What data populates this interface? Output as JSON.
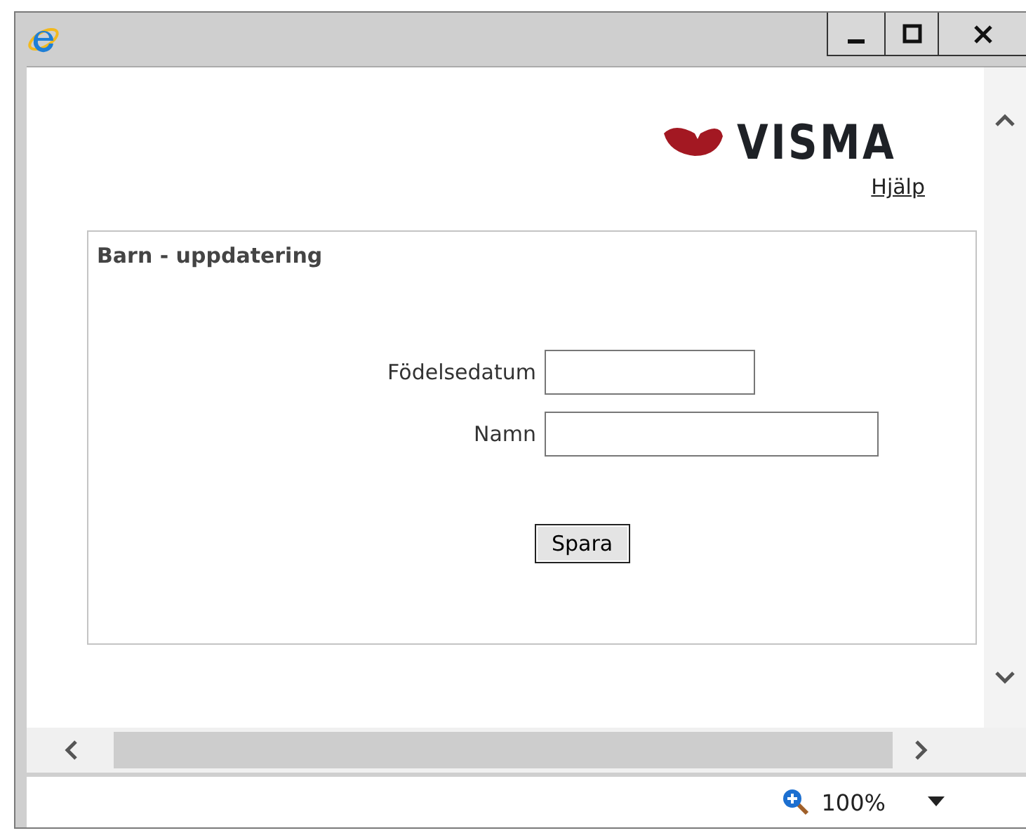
{
  "logo": {
    "text": "VISMA"
  },
  "help_link": "Hjälp",
  "form": {
    "title": "Barn - uppdatering",
    "fields": [
      {
        "label": "Födelsedatum",
        "kind": "date"
      },
      {
        "label": "Namn",
        "kind": "text"
      }
    ],
    "button": "Spara"
  },
  "status_bar": {
    "zoom": "100%"
  }
}
